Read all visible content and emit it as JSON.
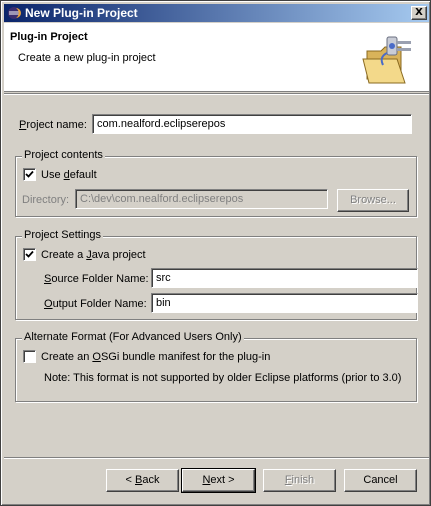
{
  "window": {
    "title": "New Plug-in Project",
    "close_glyph": "X",
    "icon": "eclipse-icon"
  },
  "banner": {
    "title": "Plug-in Project",
    "message": "Create a new plug-in project",
    "graphic": "folder-plug-graphic"
  },
  "project_name": {
    "label_pre": "",
    "label_mnemonic": "P",
    "label_post": "roject name:",
    "value": "com.nealford.eclipserepos"
  },
  "project_contents": {
    "group_label": "Project contents",
    "use_default": {
      "label_pre": "Use ",
      "label_mnemonic": "d",
      "label_post": "efault",
      "checked": true
    },
    "directory": {
      "label": "Directory:",
      "value": "C:\\dev\\com.nealford.eclipserepos",
      "browse_label": "Browse..."
    }
  },
  "project_settings": {
    "group_label": "Project Settings",
    "create_java": {
      "label_pre": "Create a ",
      "label_mnemonic": "J",
      "label_post": "ava project",
      "checked": true
    },
    "source_folder": {
      "label_pre": "",
      "label_mnemonic": "S",
      "label_post": "ource Folder Name:",
      "value": "src"
    },
    "output_folder": {
      "label_pre": "",
      "label_mnemonic": "O",
      "label_post": "utput Folder Name:",
      "value": "bin"
    }
  },
  "alternate_format": {
    "group_label": "Alternate Format (For Advanced Users Only)",
    "osgi": {
      "label_pre": "Create an ",
      "label_mnemonic": "O",
      "label_post": "SGi bundle manifest for the plug-in",
      "checked": false
    },
    "note": "Note: This format is not supported by older Eclipse platforms (prior to 3.0)"
  },
  "buttons": {
    "back": {
      "prefix": "< ",
      "mnemonic": "B",
      "rest": "ack"
    },
    "next": {
      "mnemonic": "N",
      "rest": "ext >"
    },
    "finish": {
      "mnemonic": "F",
      "rest": "inish"
    },
    "cancel": "Cancel"
  },
  "colors": {
    "titlebar_start": "#0a246a",
    "titlebar_end": "#a6caf0",
    "dialog_bg": "#d4d0c8"
  }
}
